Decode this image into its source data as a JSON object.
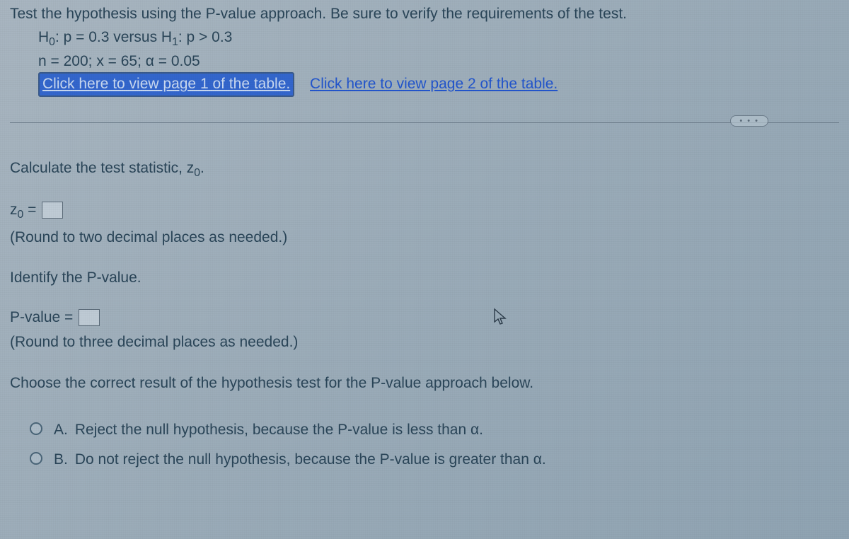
{
  "intro": "Test the hypothesis using the P-value approach. Be sure to verify the requirements of the test.",
  "hypothesis": {
    "h0_prefix": "H",
    "h0_sub": "0",
    "h0_text": ": p = 0.3 versus H",
    "h1_sub": "1",
    "h1_text": ": p > 0.3",
    "params": "n = 200; x = 65; α = 0.05",
    "link1": "Click here to view page 1 of the table.",
    "link2": "Click here to view page 2 of the table."
  },
  "more": "• • •",
  "q1": {
    "prompt_a": "Calculate the test statistic, z",
    "prompt_sub": "0",
    "prompt_b": ".",
    "answer_a": "z",
    "answer_sub": "0",
    "answer_b": " = ",
    "hint": "(Round to two decimal places as needed.)"
  },
  "q2": {
    "prompt": "Identify the P-value.",
    "answer": "P-value = ",
    "hint": "(Round to three decimal places as needed.)"
  },
  "q3": {
    "prompt": "Choose the correct result of the hypothesis test for the P-value approach below.",
    "options": [
      {
        "letter": "A.",
        "text": "Reject the null hypothesis, because the P-value is less than α."
      },
      {
        "letter": "B.",
        "text": "Do not reject the null hypothesis, because the P-value is greater than α."
      }
    ]
  }
}
